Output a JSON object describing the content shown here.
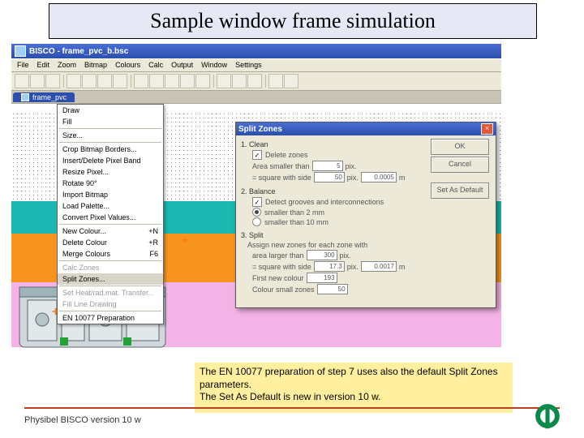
{
  "title": "Sample window frame simulation",
  "main_window_title": "BISCO - frame_pvc_b.bsc",
  "menubar": [
    "File",
    "Edit",
    "Zoom",
    "Bitmap",
    "Colours",
    "Calc",
    "Output",
    "Window",
    "Settings"
  ],
  "tab_label": "frame_pvc",
  "dropdown": {
    "items": [
      {
        "label": "Draw",
        "enabled": true
      },
      {
        "label": "Fill",
        "enabled": true
      },
      {
        "sep": true
      },
      {
        "label": "Size...",
        "enabled": true
      },
      {
        "sep": true
      },
      {
        "label": "Crop Bitmap Borders...",
        "enabled": true
      },
      {
        "label": "Insert/Delete Pixel Band",
        "enabled": true
      },
      {
        "label": "Resize Pixel...",
        "enabled": true
      },
      {
        "label": "Rotate 90°",
        "enabled": true
      },
      {
        "label": "Import Bitmap",
        "enabled": true
      },
      {
        "label": "Load Palette...",
        "enabled": true
      },
      {
        "label": "Convert Pixel Values...",
        "enabled": true
      },
      {
        "sep": true
      },
      {
        "label": "New Colour...",
        "shortcut": "+N",
        "enabled": true
      },
      {
        "label": "Delete Colour",
        "shortcut": "+R",
        "enabled": true
      },
      {
        "label": "Merge Colours",
        "shortcut": "F6",
        "enabled": true
      },
      {
        "sep": true
      },
      {
        "label": "Calc Zones",
        "enabled": false
      },
      {
        "label": "Split Zones...",
        "selected": true,
        "enabled": true
      },
      {
        "sep": true
      },
      {
        "label": "Set Heat/rad.mat. Transfer...",
        "enabled": false
      },
      {
        "label": "Fill Line Drawing",
        "enabled": false
      },
      {
        "sep": true
      },
      {
        "label": "EN 10077 Preparation",
        "enabled": true
      }
    ]
  },
  "dialog": {
    "title": "Split Zones",
    "buttons": {
      "ok": "OK",
      "cancel": "Cancel",
      "setdefault": "Set As Default"
    },
    "g1": {
      "label": "1. Clean",
      "chk": "Delete zones",
      "line_a_pre": "Area smaller than",
      "line_a_val": "5",
      "line_a_unit": "pix.",
      "line_b_pre": "= square with side",
      "line_b_val": "50",
      "line_b_unit_pix": "pix.",
      "line_b_val_m": "0.0005",
      "line_b_unit_m": "m"
    },
    "g2": {
      "label": "2. Balance",
      "chk": "Detect grooves and interconnections",
      "opt1": "smaller than 2 mm",
      "opt2": "smaller than 10 mm"
    },
    "g3": {
      "label": "3. Split",
      "header": "Assign new zones for each zone with",
      "line_a_pre": "area larger than",
      "line_a_val": "300",
      "line_a_unit": "pix.",
      "line_b_pre": "= square with side",
      "line_b_val": "17.3",
      "line_b_unit_pix": "pix.",
      "line_b_val_m": "0.0017",
      "line_b_unit_m": "m",
      "line_c": "First new colour",
      "line_c_val": "193",
      "line_d": "Colour small zones",
      "line_d_val": "50"
    }
  },
  "caption_line1": "The EN 10077 preparation of step 7 uses also the default Split Zones parameters.",
  "caption_line2": "The Set As Default is new in version 10 w.",
  "footer": "Physibel BISCO version 10 w"
}
